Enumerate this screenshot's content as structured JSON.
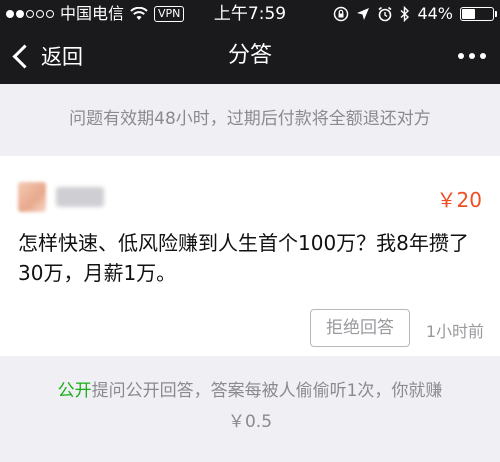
{
  "status_bar": {
    "carrier": "中国电信",
    "vpn": "VPN",
    "time": "上午7:59",
    "battery": "44%",
    "battery_level": 0.44,
    "signal_bars_filled": 2,
    "signal_bars_total": 5,
    "icons": [
      "wifi-icon",
      "rotation-lock-icon",
      "location-arrow-icon",
      "alarm-icon",
      "bluetooth-icon",
      "battery-icon"
    ]
  },
  "nav": {
    "back_label": "返回",
    "title": "分答",
    "more_icon": "more-dots-icon"
  },
  "notice": {
    "text": "问题有效期48小时，过期后付款将全额退还对方"
  },
  "question_card": {
    "price": "￥20",
    "question_text": "怎样快速、低风险赚到人生首个100万？我8年攒了30万，月薪1万。",
    "reject_button": "拒绝回答",
    "time_ago": "1小时前"
  },
  "public_info": {
    "link": "公开",
    "text": "提问公开回答，答案每被人偷偷听1次，你就赚",
    "amount": "￥0.5"
  },
  "colors": {
    "header_bg": "#1a1a1d",
    "page_bg": "#efeff4",
    "price": "#f04e23",
    "accent_green": "#1aad19",
    "muted_text": "#8a8a8f"
  }
}
